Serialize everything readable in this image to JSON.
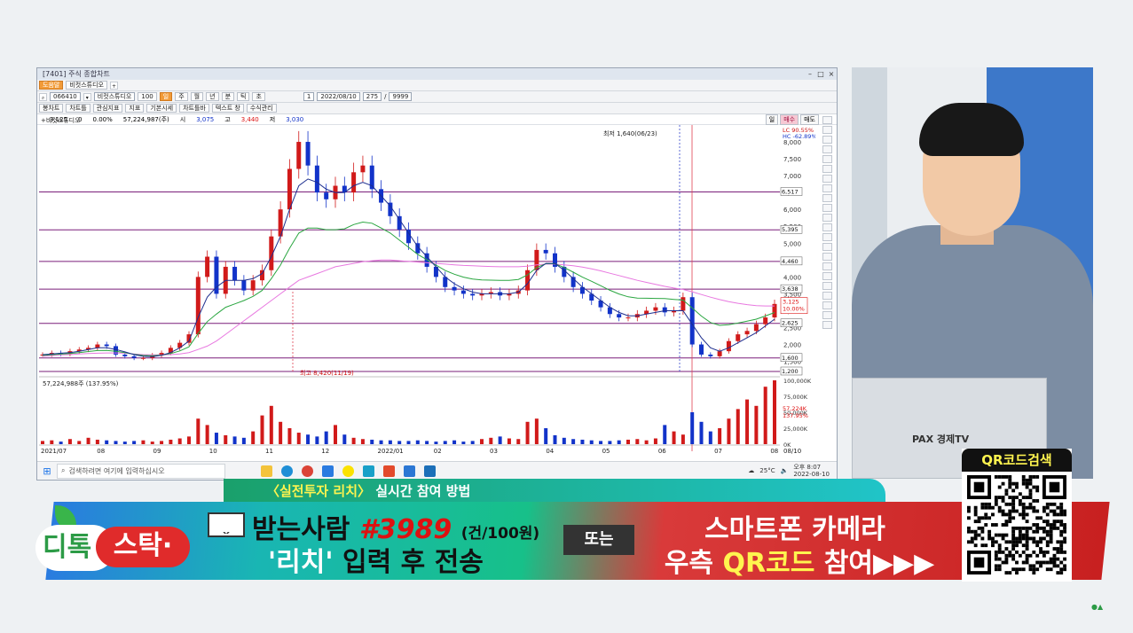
{
  "window": {
    "title": "[7401] 주식 종합차트",
    "tab_label": "비컷스튜디오",
    "help_button": "도움말",
    "code": "066410",
    "name": "비컷스튜디오",
    "count_box": "100",
    "period_buttons": [
      "주",
      "월",
      "년",
      "분",
      "틱",
      "초"
    ],
    "page_num": "1",
    "date": "2022/08/10",
    "bars_shown": "275",
    "bars_total": "9999"
  },
  "toolbar2": {
    "items": [
      "봉차트",
      "차트틀",
      "관심지표",
      "지표",
      "기본시세",
      "차트틀바",
      "텍스트 창",
      "수식관리"
    ]
  },
  "info": {
    "price": "3,125",
    "change": "0",
    "change_pct": "0.00%",
    "volume": "57,224,987(주)",
    "open_label": "시",
    "open": "3,075",
    "high_label": "고",
    "high": "3,440",
    "low_label": "저",
    "low": "3,030",
    "right_buttons": [
      "일",
      "매수",
      "매도"
    ]
  },
  "chart_data": {
    "type": "line",
    "title": "비컷스튜디오",
    "x_ticks": [
      "2021/07",
      "08",
      "09",
      "10",
      "11",
      "12",
      "2022/01",
      "02",
      "03",
      "04",
      "05",
      "06",
      "07",
      "08",
      "08/10"
    ],
    "y_ticks": [
      "8,000",
      "7,500",
      "7,000",
      "6,500",
      "6,000",
      "5,500",
      "5,000",
      "4,500",
      "4,000",
      "3,500",
      "3,000",
      "2,500",
      "2,000",
      "1,500"
    ],
    "hlines": [
      "6,517",
      "5,395",
      "4,460",
      "3,638",
      "2,625",
      "1,600",
      "1,200"
    ],
    "annotations": {
      "max_label": "최저 1,640(06/23)",
      "min_label": "최고 8,420(11/19)",
      "lc": "LC  90.55%",
      "hc": "HC  -62.89%",
      "current_price": "3,125",
      "current_pct": "10.00%"
    },
    "price": [
      1700,
      1750,
      1720,
      1800,
      1850,
      1900,
      2000,
      1950,
      1700,
      1650,
      1600,
      1600,
      1680,
      1750,
      1900,
      2050,
      2300,
      4000,
      4600,
      3500,
      4300,
      3900,
      3600,
      3900,
      4200,
      5200,
      6000,
      7200,
      8000,
      7300,
      6500,
      6300,
      6700,
      6500,
      7100,
      7300,
      6600,
      6200,
      5800,
      5400,
      5000,
      4700,
      4300,
      4000,
      3700,
      3600,
      3500,
      3450,
      3500,
      3550,
      3450,
      3500,
      3600,
      4200,
      4800,
      4700,
      4300,
      4000,
      3700,
      3500,
      3300,
      3100,
      2900,
      2800,
      2800,
      2900,
      3000,
      3100,
      2950,
      3000,
      3400,
      2000,
      1700,
      1650,
      1800,
      2100,
      2300,
      2400,
      2600,
      2800,
      3200
    ],
    "ma_short": [
      1700,
      1720,
      1740,
      1760,
      1800,
      1850,
      1900,
      1900,
      1850,
      1780,
      1700,
      1650,
      1640,
      1680,
      1760,
      1900,
      2100,
      2800,
      3400,
      3700,
      3900,
      3900,
      3900,
      3950,
      4100,
      4600,
      5200,
      6000,
      6700,
      6900,
      6800,
      6600,
      6500,
      6500,
      6700,
      6800,
      6700,
      6400,
      6100,
      5700,
      5300,
      4900,
      4600,
      4300,
      4000,
      3800,
      3650,
      3550,
      3500,
      3500,
      3500,
      3500,
      3550,
      3800,
      4200,
      4400,
      4400,
      4200,
      3950,
      3700,
      3500,
      3300,
      3100,
      2950,
      2850,
      2850,
      2900,
      2950,
      3000,
      3000,
      3000,
      2600,
      2200,
      1900,
      1800,
      1900,
      2050,
      2200,
      2350,
      2550,
      2750
    ],
    "ma_long": [
      1650,
      1670,
      1690,
      1700,
      1720,
      1730,
      1740,
      1750,
      1750,
      1740,
      1720,
      1700,
      1690,
      1690,
      1700,
      1720,
      1760,
      1850,
      1950,
      2100,
      2300,
      2500,
      2700,
      2900,
      3100,
      3300,
      3500,
      3700,
      3900,
      4000,
      4100,
      4200,
      4300,
      4350,
      4400,
      4450,
      4480,
      4500,
      4500,
      4480,
      4460,
      4440,
      4420,
      4400,
      4380,
      4360,
      4340,
      4330,
      4320,
      4310,
      4300,
      4300,
      4300,
      4320,
      4360,
      4380,
      4380,
      4360,
      4330,
      4290,
      4240,
      4180,
      4110,
      4040,
      3970,
      3900,
      3840,
      3780,
      3720,
      3670,
      3630,
      3560,
      3480,
      3400,
      3330,
      3270,
      3220,
      3180,
      3150,
      3140,
      3140
    ],
    "volume_label": "57,224,988주 (137.95%)",
    "volume_ticks": [
      "100,000K",
      "75,000K",
      "50,000K",
      "25,000K",
      "0K"
    ],
    "volume_current": "57,224K",
    "volume_pct": "137.95%",
    "volume": [
      5,
      6,
      4,
      8,
      5,
      10,
      7,
      6,
      5,
      4,
      5,
      6,
      4,
      5,
      7,
      9,
      12,
      40,
      30,
      18,
      14,
      12,
      10,
      20,
      45,
      60,
      35,
      25,
      18,
      15,
      12,
      20,
      30,
      15,
      10,
      8,
      7,
      6,
      6,
      5,
      5,
      6,
      5,
      4,
      5,
      6,
      4,
      5,
      8,
      10,
      12,
      9,
      8,
      35,
      40,
      25,
      14,
      10,
      8,
      7,
      6,
      5,
      5,
      6,
      7,
      8,
      6,
      9,
      30,
      20,
      15,
      50,
      35,
      20,
      25,
      40,
      55,
      70,
      60,
      90,
      100
    ]
  },
  "taskbar": {
    "search_placeholder": "검색하려면 여기에 입력하십시오",
    "weather": "25°C",
    "time": "오후 8:07",
    "date": "2022-08-10"
  },
  "video": {
    "laptop_brand": "PAX 경제TV"
  },
  "banner": {
    "top_title": "〈실전투자 리치〉",
    "top_rest": " 실시간 참여 방법",
    "logo_di": "디톡",
    "logo_stak": "스탁·",
    "recipient": "받는사람",
    "number": "#3989",
    "fee": "(건/100원)",
    "rich_word": "'리치'",
    "rich_rest": " 입력 후 전송",
    "or": "또는",
    "right_line1": "스마트폰 카메라",
    "right_line2_a": "우측 ",
    "right_line2_b": "QR코드",
    "right_line2_c": " 참여▶▶▶",
    "qr_title": "QR코드검색"
  },
  "colors": {
    "up": "#d11a1a",
    "down": "#1233c9",
    "hline": "#7a1f7a",
    "ma_short": "#1e2f8f",
    "ma_mid": "#2aa640",
    "ma_long": "#e878e0"
  }
}
